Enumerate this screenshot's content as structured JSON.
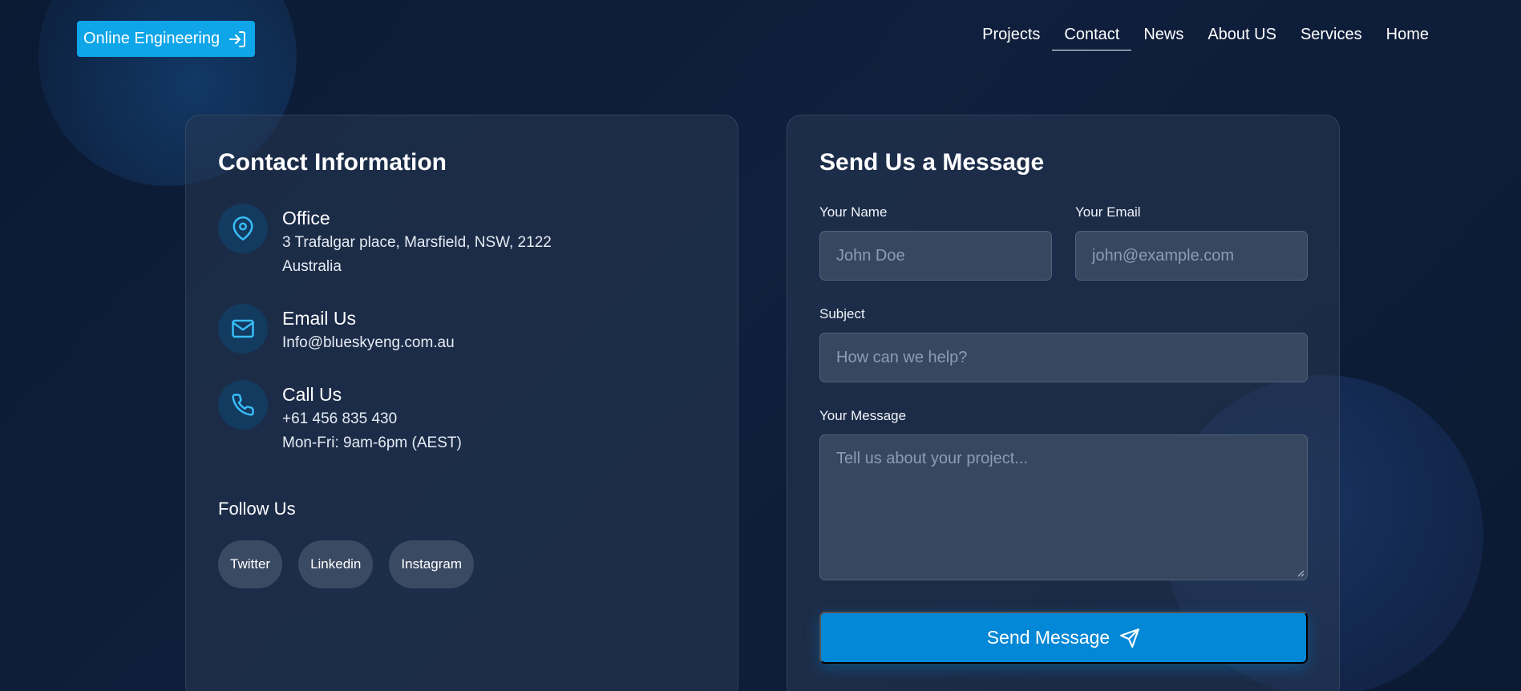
{
  "header": {
    "brand_label": "Online Engineering",
    "nav": [
      "Projects",
      "Contact",
      "News",
      "About US",
      "Services",
      "Home"
    ],
    "active_nav": "Contact"
  },
  "contact_info": {
    "title": "Contact Information",
    "office": {
      "heading": "Office",
      "line1": "3 Trafalgar place, Marsfield, NSW, 2122",
      "line2": "Australia",
      "icon": "map-pin-icon"
    },
    "email": {
      "heading": "Email Us",
      "line1": "Info@blueskyeng.com.au",
      "icon": "mail-icon"
    },
    "phone": {
      "heading": "Call Us",
      "line1": "+61 456 835 430",
      "line2": "Mon-Fri: 9am-6pm (AEST)",
      "icon": "phone-icon"
    },
    "follow_title": "Follow Us",
    "socials": [
      "Twitter",
      "Linkedin",
      "Instagram"
    ]
  },
  "form": {
    "title": "Send Us a Message",
    "name_label": "Your Name",
    "name_placeholder": "John Doe",
    "email_label": "Your Email",
    "email_placeholder": "john@example.com",
    "subject_label": "Subject",
    "subject_placeholder": "How can we help?",
    "message_label": "Your Message",
    "message_placeholder": "Tell us about your project...",
    "submit_label": "Send Message"
  },
  "colors": {
    "accent": "#0ea5e9",
    "button": "#0288d6",
    "icon": "#38bdf8",
    "background": "#0f1f3d"
  }
}
